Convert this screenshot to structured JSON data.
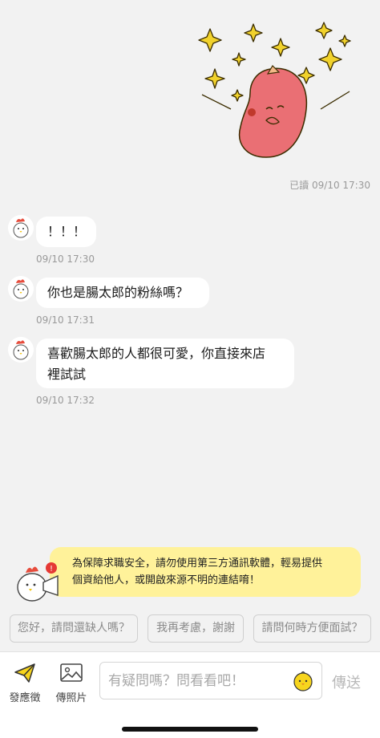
{
  "read_receipt": {
    "status": "已讀",
    "time": "09/10 17:30"
  },
  "messages": [
    {
      "line1": "！！！",
      "line2": "",
      "time": "09/10 17:30"
    },
    {
      "line1": "你也是腸太郎的粉絲嗎？",
      "line2": "",
      "time": "09/10 17:31"
    },
    {
      "line1": "喜歡腸太郎的人都很可愛，你直接來店",
      "line2": "裡試試",
      "time": "09/10 17:32"
    }
  ],
  "notice": {
    "line1": "為保障求職安全，請勿使用第三方通訊軟體，輕易提供",
    "line2": "個資給他人，或開啟來源不明的連結唷！"
  },
  "quick_replies": [
    "您好，請問還缺人嗎？",
    "我再考慮，謝謝",
    "請問何時方便面試？"
  ],
  "toolbar": {
    "apply_label": "發應徵",
    "photo_label": "傳照片",
    "input_placeholder": "有疑問嗎？問看看吧！",
    "send_label": "傳送"
  },
  "colors": {
    "background": "#f2f2f2",
    "notice_bg": "#fff29a",
    "accent_yellow": "#f7d51d",
    "sticker_body": "#ea6f74"
  },
  "icons": [
    "sparkle-sticker",
    "chicken-avatar-icon",
    "warning-icon",
    "paper-plane-icon",
    "image-icon",
    "chick-emoji-icon"
  ]
}
